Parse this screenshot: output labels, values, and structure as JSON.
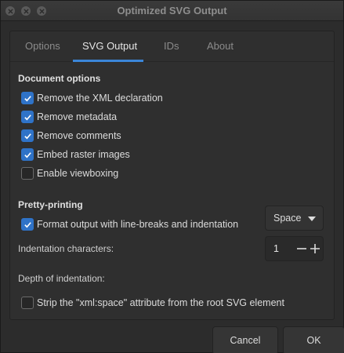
{
  "window": {
    "title": "Optimized SVG Output"
  },
  "tabs": [
    {
      "label": "Options"
    },
    {
      "label": "SVG Output"
    },
    {
      "label": "IDs"
    },
    {
      "label": "About"
    }
  ],
  "document_options": {
    "heading": "Document options",
    "items": [
      {
        "label": "Remove the XML declaration",
        "checked": true
      },
      {
        "label": "Remove metadata",
        "checked": true
      },
      {
        "label": "Remove comments",
        "checked": true
      },
      {
        "label": "Embed raster images",
        "checked": true
      },
      {
        "label": "Enable viewboxing",
        "checked": false
      }
    ]
  },
  "pretty_printing": {
    "heading": "Pretty-printing",
    "format_output": {
      "label": "Format output with line-breaks and indentation",
      "checked": true
    },
    "indentation_characters": {
      "label": "Indentation characters:",
      "value": "Space"
    },
    "depth_of_indentation": {
      "label": "Depth of indentation:",
      "value": "1"
    },
    "strip_xml_space": {
      "label": "Strip the \"xml:space\" attribute from the root SVG element",
      "checked": false
    }
  },
  "buttons": {
    "cancel": "Cancel",
    "ok": "OK"
  },
  "colors": {
    "accent": "#3b86d8",
    "checkbox": "#2f73c8",
    "background": "#2c2c2c"
  }
}
